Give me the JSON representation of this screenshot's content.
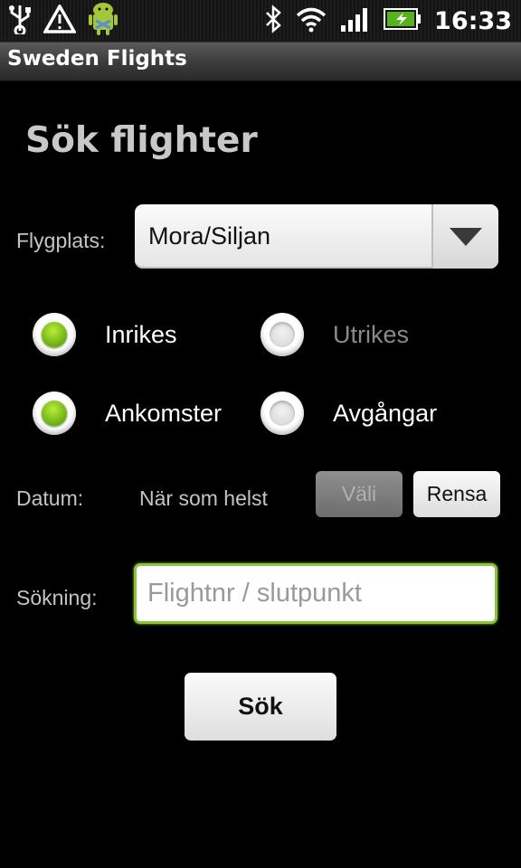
{
  "status_bar": {
    "time": "16:33",
    "icons": [
      "usb-icon",
      "warning-icon",
      "android-debug-icon",
      "bluetooth-icon",
      "wifi-icon",
      "signal-icon",
      "battery-icon"
    ]
  },
  "app": {
    "title": "Sweden Flights"
  },
  "page": {
    "heading": "Sök flighter"
  },
  "airport": {
    "label": "Flygplats:",
    "selected": "Mora/Siljan"
  },
  "radios": {
    "domestic": {
      "label": "Inrikes",
      "checked": true
    },
    "international": {
      "label": "Utrikes",
      "checked": false
    },
    "arrivals": {
      "label": "Ankomster",
      "checked": true
    },
    "departures": {
      "label": "Avgångar",
      "checked": false
    }
  },
  "date": {
    "label": "Datum:",
    "value": "När som helst",
    "choose_button": "Väli",
    "clear_button": "Rensa"
  },
  "search": {
    "label": "Sökning:",
    "placeholder": "Flightnr / slutpunkt",
    "value": ""
  },
  "submit": {
    "label": "Sök"
  },
  "colors": {
    "accent_green": "#8bc43a",
    "radio_green": "#7cc11b",
    "background": "#000000"
  }
}
